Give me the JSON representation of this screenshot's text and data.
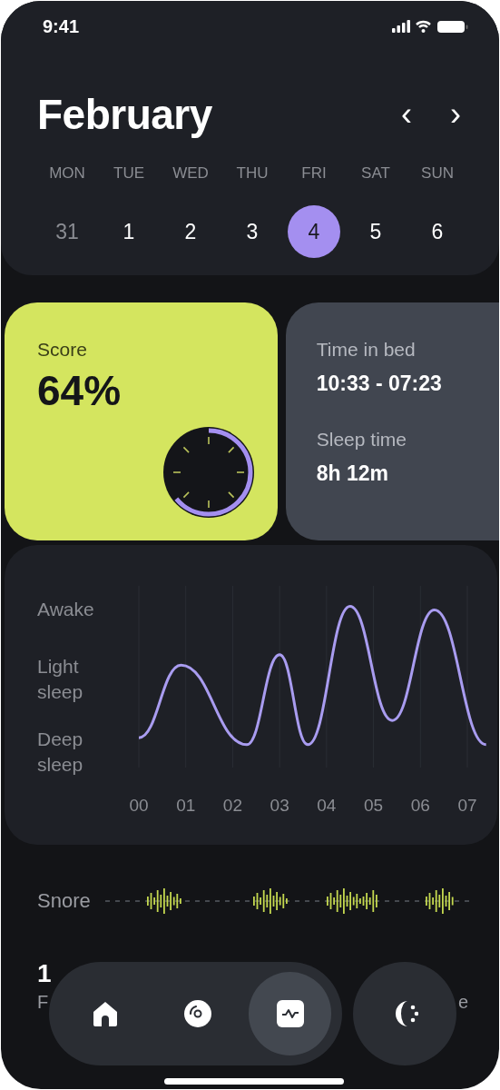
{
  "status_bar": {
    "time": "9:41"
  },
  "header": {
    "month": "February",
    "prev": "‹",
    "next": "›"
  },
  "weekdays": [
    "MON",
    "TUE",
    "WED",
    "THU",
    "FRI",
    "SAT",
    "SUN"
  ],
  "days": [
    {
      "label": "31",
      "outside_month": true,
      "selected": false
    },
    {
      "label": "1",
      "outside_month": false,
      "selected": false
    },
    {
      "label": "2",
      "outside_month": false,
      "selected": false
    },
    {
      "label": "3",
      "outside_month": false,
      "selected": false
    },
    {
      "label": "4",
      "outside_month": false,
      "selected": true
    },
    {
      "label": "5",
      "outside_month": false,
      "selected": false
    },
    {
      "label": "6",
      "outside_month": false,
      "selected": false
    }
  ],
  "score": {
    "label": "Score",
    "value": "64%",
    "level": 0.64
  },
  "time_card": [
    {
      "label": "Time in bed",
      "value": "10:33 - 07:23"
    },
    {
      "label": "Sleep time",
      "value": "8h 12m"
    }
  ],
  "sleep_chart": {
    "stage_labels": [
      "Awake",
      "Light sleep",
      "Deep sleep"
    ],
    "hour_labels": [
      "00",
      "01",
      "02",
      "03",
      "04",
      "05",
      "06",
      "07"
    ]
  },
  "snore": {
    "label": "Snore"
  },
  "stats": {
    "left_value": "1",
    "left_label": "F",
    "right_label": "e"
  },
  "nav": [
    {
      "kind": "home",
      "selected": false
    },
    {
      "kind": "disc",
      "selected": false
    },
    {
      "kind": "activity",
      "selected": true
    }
  ],
  "side_button": {
    "kind": "moon"
  }
}
